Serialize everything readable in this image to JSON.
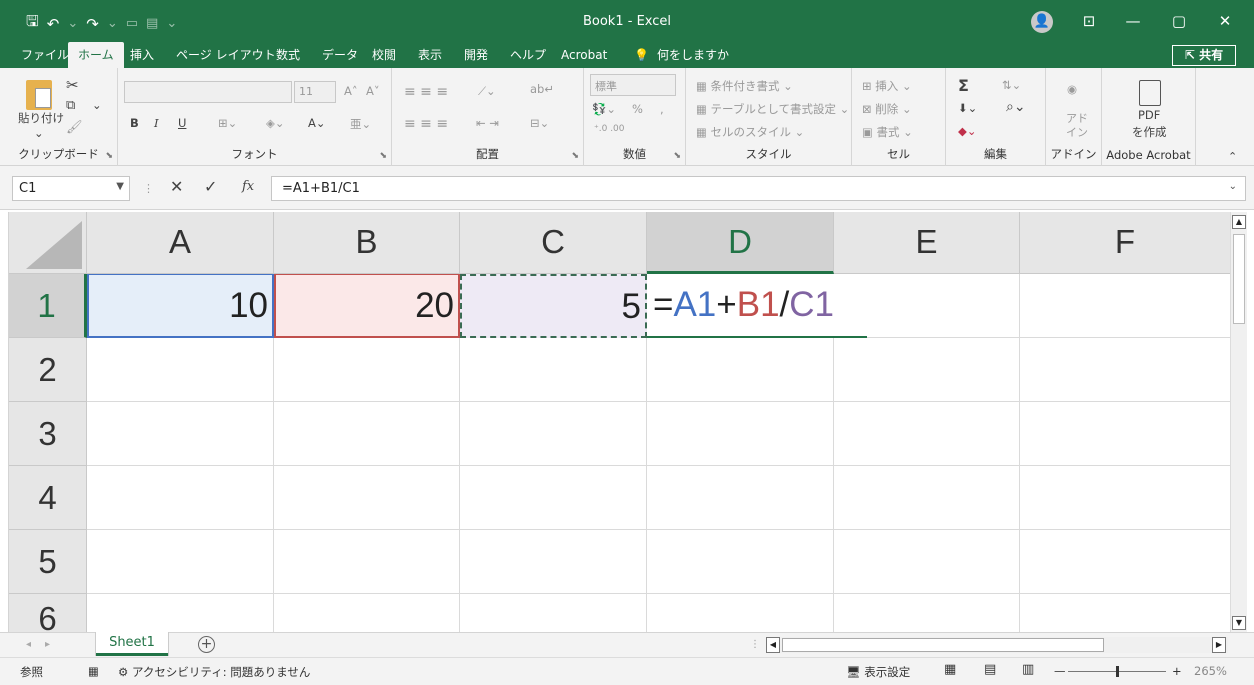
{
  "app": {
    "title": "Book1  -  Excel",
    "qat": {
      "save_icon": "save-icon",
      "undo_icon": "undo-icon",
      "redo_icon": "redo-icon"
    },
    "window": {
      "ribbon_display": "⊡",
      "minimize": "—",
      "restore": "▢",
      "close": "✕"
    }
  },
  "ribbon_tabs": {
    "items": [
      "ファイル",
      "ホーム",
      "挿入",
      "ページ レイアウト",
      "数式",
      "データ",
      "校閲",
      "表示",
      "開発",
      "ヘルプ",
      "Acrobat"
    ],
    "active": "ホーム",
    "tell_me": "何をしますか",
    "share": "共有"
  },
  "ribbon": {
    "clipboard": {
      "label": "クリップボード",
      "paste": "貼り付け"
    },
    "font": {
      "label": "フォント",
      "size": "11",
      "bold": "B",
      "italic": "I",
      "underline": "U",
      "grow": "A˄",
      "shrink": "A˅",
      "font_color": "A"
    },
    "alignment": {
      "label": "配置"
    },
    "number": {
      "label": "数値",
      "format": "標準",
      "percent": "%",
      "comma": ","
    },
    "styles": {
      "label": "スタイル",
      "conditional": "条件付き書式",
      "table": "テーブルとして書式設定",
      "cell_styles": "セルのスタイル"
    },
    "cells": {
      "label": "セル",
      "insert": "挿入",
      "delete": "削除",
      "format": "書式"
    },
    "editing": {
      "label": "編集",
      "sum": "Σ"
    },
    "addins": {
      "label": "アドイン",
      "button_line1": "アド",
      "button_line2": "イン"
    },
    "acrobat": {
      "label": "Adobe Acrobat",
      "button_line1": "PDF",
      "button_line2": "を作成"
    }
  },
  "formula_bar": {
    "name_box": "C1",
    "cancel": "✕",
    "enter": "✓",
    "fx": "fx",
    "formula": "=A1+B1/C1"
  },
  "sheet": {
    "columns": [
      "A",
      "B",
      "C",
      "D",
      "E",
      "F"
    ],
    "rows": [
      "1",
      "2",
      "3",
      "4",
      "5",
      "6"
    ],
    "selected_column": "D",
    "selected_row": "1",
    "cells": {
      "A1": "10",
      "B1": "20",
      "C1": "5",
      "D1_parts": {
        "eq": "=",
        "ref1": "A1",
        "op1": "+",
        "ref2": "B1",
        "op2": "/",
        "ref3": "C1"
      }
    },
    "reference_colors": {
      "A1": "#4472c4",
      "B1": "#c0504d",
      "C1": "#8064a2"
    }
  },
  "sheet_tabs": {
    "active": "Sheet1",
    "add": "+"
  },
  "status_bar": {
    "mode": "参照",
    "accessibility": "アクセシビリティ: 問題ありません",
    "display_settings": "表示設定",
    "zoom_minus": "—",
    "zoom_plus": "+",
    "zoom": "265%"
  },
  "colors": {
    "brand": "#217346",
    "ribbon_bg": "#f3f3f3"
  }
}
